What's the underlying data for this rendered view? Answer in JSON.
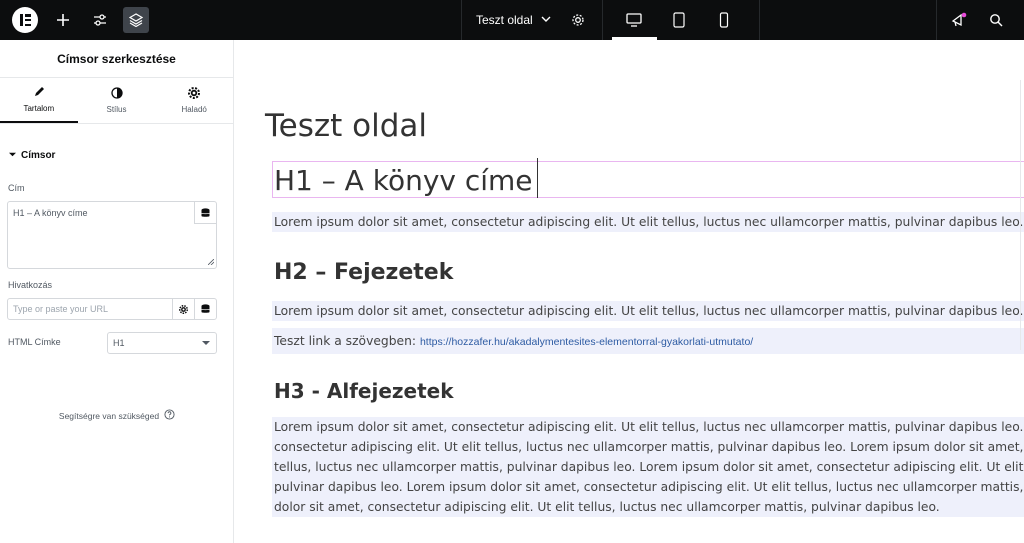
{
  "topbar": {
    "page_title": "Teszt oldal",
    "icons": [
      "elementor-logo",
      "plus-icon",
      "sliders-icon",
      "layers-icon",
      "chevron-down-icon",
      "gear-icon",
      "desktop-icon",
      "tablet-icon",
      "mobile-icon",
      "megaphone-icon",
      "search-icon"
    ]
  },
  "panel": {
    "title": "Címsor szerkesztése",
    "tabs": [
      {
        "label": "Tartalom",
        "icon": "pencil-icon",
        "active": true
      },
      {
        "label": "Stílus",
        "icon": "half-circle-icon",
        "active": false
      },
      {
        "label": "Haladó",
        "icon": "gear-icon",
        "active": false
      }
    ],
    "section": "Címsor",
    "title_label": "Cím",
    "title_value": "H1 – A könyv címe",
    "link_label": "Hivatkozás",
    "link_placeholder": "Type or paste your URL",
    "html_tag_label": "HTML Címke",
    "html_tag_value": "H1",
    "help": "Segítségre van szükséged"
  },
  "canvas": {
    "page_title": "Teszt oldal",
    "h1": "H1 – A könyv címe",
    "para1": "Lorem ipsum dolor sit amet, consectetur adipiscing elit. Ut elit tellus, luctus nec ullamcorper mattis, pulvinar dapibus leo.",
    "h2": "H2 – Fejezetek",
    "para2": "Lorem ipsum dolor sit amet, consectetur adipiscing elit. Ut elit tellus, luctus nec ullamcorper mattis, pulvinar dapibus leo.",
    "link_text": "Teszt link a szövegben:",
    "link_url": "https://hozzafer.hu/akadalymentesites-elementorral-gyakorlati-utmutato/",
    "h3": "H3 - Alfejezetek",
    "long_lines": [
      "Lorem ipsum dolor sit amet, consectetur adipiscing elit. Ut elit tellus, luctus nec ullamcorper mattis, pulvinar dapibus leo. Lorem ipsum",
      "consectetur adipiscing elit. Ut elit tellus, luctus nec ullamcorper mattis, pulvinar dapibus leo. Lorem ipsum dolor sit amet, consectetur",
      "tellus, luctus nec ullamcorper mattis, pulvinar dapibus leo. Lorem ipsum dolor sit amet, consectetur adipiscing elit. Ut elit tellus, luctus",
      "pulvinar dapibus leo. Lorem ipsum dolor sit amet, consectetur adipiscing elit. Ut elit tellus, luctus nec ullamcorper mattis, pulvinar dap",
      "dolor sit amet, consectetur adipiscing elit. Ut elit tellus, luctus nec ullamcorper mattis, pulvinar dapibus leo."
    ]
  }
}
